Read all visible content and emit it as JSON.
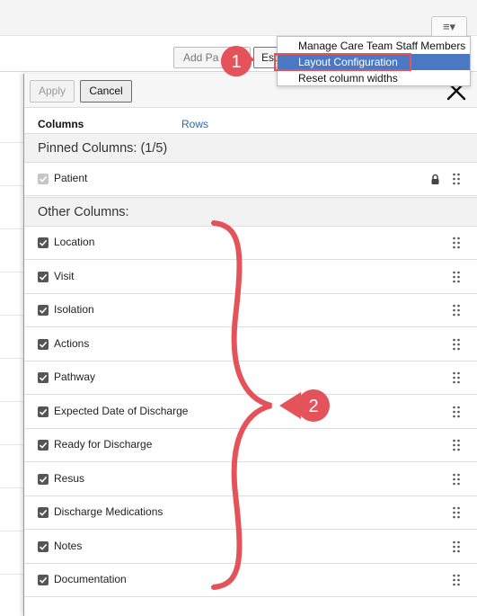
{
  "background": {
    "menu_trigger_glyph": "≡▾",
    "toolbar_buttons": [
      "Add Pa",
      "Est"
    ]
  },
  "dropdown": {
    "items": [
      {
        "label": "Manage Care Team Staff Members",
        "active": false
      },
      {
        "label": "Layout Configuration",
        "active": true
      },
      {
        "label": "Reset column widths",
        "active": false
      }
    ]
  },
  "panel": {
    "apply_label": "Apply",
    "cancel_label": "Cancel",
    "tabs": {
      "columns": "Columns",
      "rows": "Rows"
    },
    "pinned_heading": "Pinned Columns: (1/5)",
    "other_heading": "Other Columns:",
    "pinned_columns": [
      {
        "label": "Patient",
        "checked": true,
        "disabled": true,
        "locked": true
      }
    ],
    "other_columns": [
      {
        "label": "Location",
        "checked": true
      },
      {
        "label": "Visit",
        "checked": true
      },
      {
        "label": "Isolation",
        "checked": true
      },
      {
        "label": "Actions",
        "checked": true
      },
      {
        "label": "Pathway",
        "checked": true
      },
      {
        "label": "Expected Date of Discharge",
        "checked": true
      },
      {
        "label": "Ready for Discharge",
        "checked": true
      },
      {
        "label": "Resus",
        "checked": true
      },
      {
        "label": "Discharge Medications",
        "checked": true
      },
      {
        "label": "Notes",
        "checked": true
      },
      {
        "label": "Documentation",
        "checked": true
      }
    ]
  },
  "annotations": {
    "marker_1": "1",
    "marker_2": "2",
    "color": "#e4525a"
  }
}
